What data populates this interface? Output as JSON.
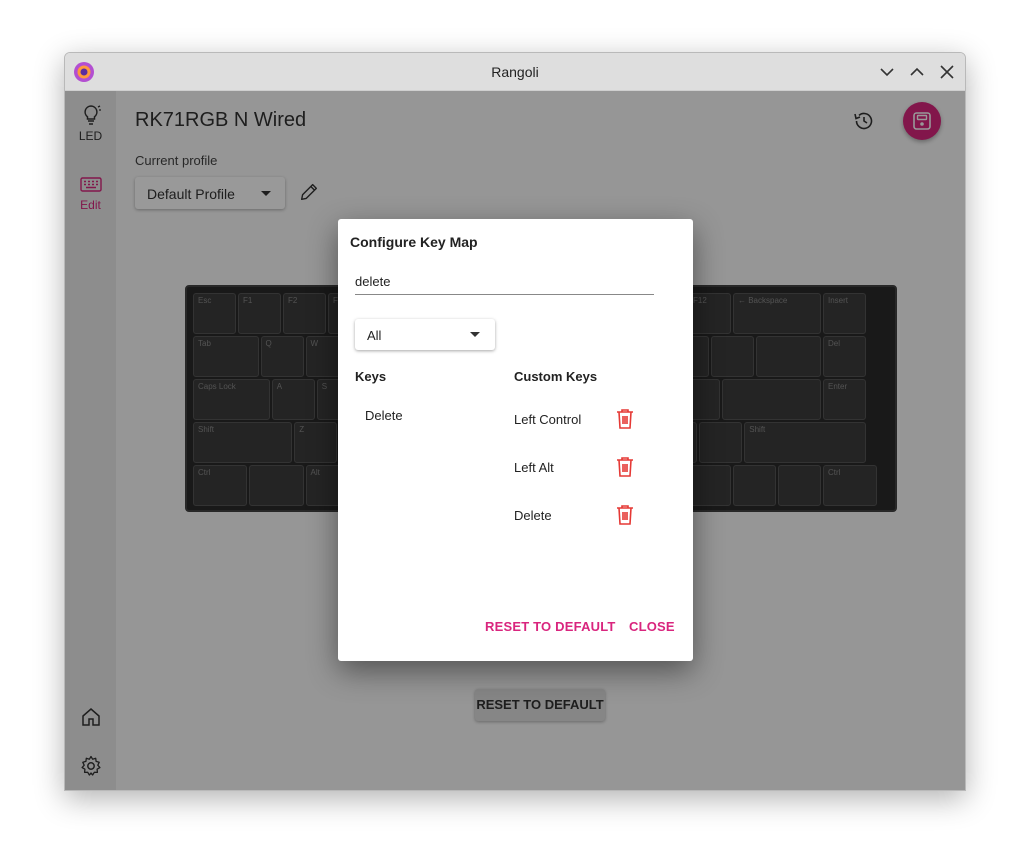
{
  "window": {
    "title": "Rangoli"
  },
  "sidebar": {
    "items": [
      {
        "label": "LED",
        "icon": "lightbulb-icon"
      },
      {
        "label": "Edit",
        "icon": "keyboard-icon"
      }
    ],
    "bottom": [
      {
        "icon": "home-icon"
      },
      {
        "icon": "gear-icon"
      }
    ]
  },
  "header": {
    "device_name": "RK71RGB N Wired",
    "profile_label": "Current profile",
    "profile_value": "Default Profile"
  },
  "main": {
    "reset_label": "RESET TO DEFAULT"
  },
  "keyboard": {
    "rows": [
      [
        "Esc",
        "F1",
        "F2",
        "F3",
        "",
        "",
        "",
        "",
        "",
        "",
        "",
        "F12",
        "← Backspace",
        "Insert",
        "Home"
      ],
      [
        "Tab",
        "Q",
        "W",
        "",
        "",
        "",
        "",
        "",
        "",
        "",
        "",
        "",
        "",
        "Del",
        "End"
      ],
      [
        "Caps Lock",
        "A",
        "S",
        "",
        "",
        "",
        "",
        "",
        "",
        "",
        "",
        "",
        "Enter",
        "PgUp",
        "PgDn"
      ],
      [
        "Shift",
        "Z",
        "",
        "",
        "",
        "",
        "",
        "",
        "",
        "",
        "",
        "Shift",
        "↑",
        "↓"
      ],
      [
        "Ctrl",
        "",
        "Alt",
        "",
        "",
        "",
        "",
        "",
        "Ctrl",
        "←",
        "↓",
        "→"
      ]
    ]
  },
  "dialog": {
    "title": "Configure Key Map",
    "search_value": "delete",
    "filter_value": "All",
    "keys_header": "Keys",
    "custom_header": "Custom Keys",
    "keys": [
      "Delete"
    ],
    "custom_keys": [
      "Left Control",
      "Left Alt",
      "Delete"
    ],
    "reset_label": "RESET TO DEFAULT",
    "close_label": "CLOSE"
  },
  "colors": {
    "accent": "#d9257e",
    "danger": "#e53935"
  }
}
